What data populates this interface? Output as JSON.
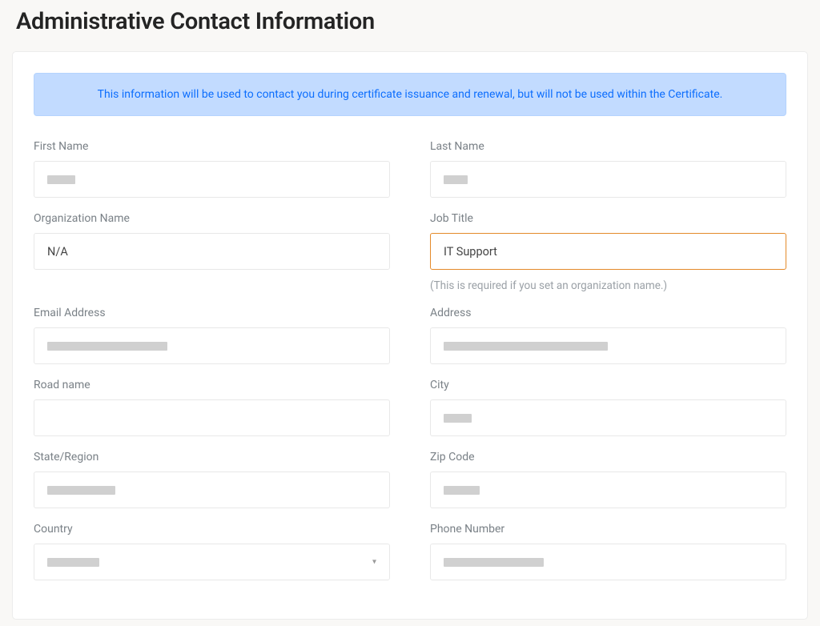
{
  "page": {
    "title": "Administrative Contact Information"
  },
  "banner": {
    "message": "This information will be used to contact you during certificate issuance and renewal, but will not be used within the Certificate."
  },
  "form": {
    "first_name": {
      "label": "First Name",
      "value": "",
      "redacted": true,
      "redacted_width": "w35"
    },
    "last_name": {
      "label": "Last Name",
      "value": "",
      "redacted": true,
      "redacted_width": "w30"
    },
    "organization_name": {
      "label": "Organization Name",
      "value": "N/A",
      "redacted": false
    },
    "job_title": {
      "label": "Job Title",
      "value": "IT Support",
      "help": "(This is required if you set an organization name.)",
      "focused": true,
      "redacted": false
    },
    "email_address": {
      "label": "Email Address",
      "value": "",
      "redacted": true,
      "redacted_width": "w150"
    },
    "address": {
      "label": "Address",
      "value": "",
      "redacted": true,
      "redacted_width": "w205"
    },
    "road_name": {
      "label": "Road name",
      "value": "",
      "redacted": false
    },
    "city": {
      "label": "City",
      "value": "",
      "redacted": true,
      "redacted_width": "w35"
    },
    "state_region": {
      "label": "State/Region",
      "value": "",
      "redacted": true,
      "redacted_width": "w85"
    },
    "zip_code": {
      "label": "Zip Code",
      "value": "",
      "redacted": true,
      "redacted_width": "w45"
    },
    "country": {
      "label": "Country",
      "value": "",
      "type": "select",
      "redacted": true,
      "redacted_width": "w65"
    },
    "phone_number": {
      "label": "Phone Number",
      "value": "",
      "redacted": true,
      "redacted_width": "w125"
    }
  }
}
